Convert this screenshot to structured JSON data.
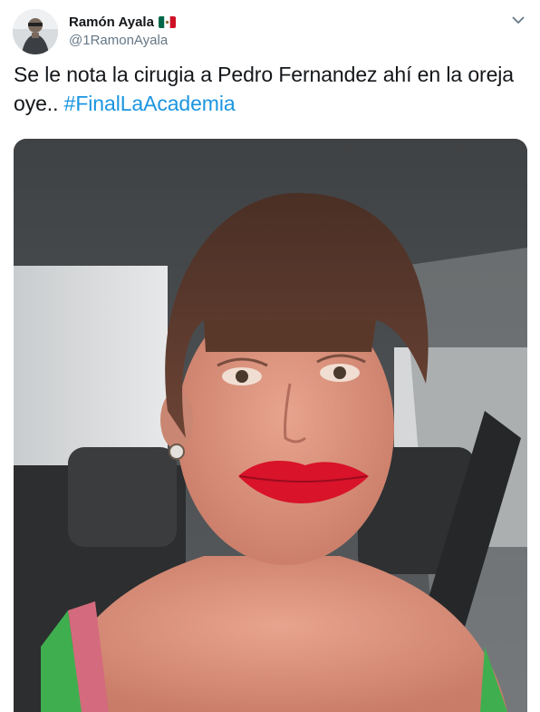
{
  "tweet": {
    "author": {
      "display_name": "Ramón Ayala",
      "flag_icon": "mexico-flag-icon",
      "handle": "@1RamonAyala"
    },
    "menu_icon": "chevron-down-icon",
    "text_plain": "Se le nota la cirugia a Pedro Fernandez ahí en la oreja oye.. ",
    "hashtag": "#FinalLaAcademia",
    "colors": {
      "text": "#14171a",
      "secondary": "#657786",
      "link": "#1b95e0"
    },
    "media": {
      "type": "video-thumbnail",
      "subject": "person-in-car-photo"
    }
  }
}
